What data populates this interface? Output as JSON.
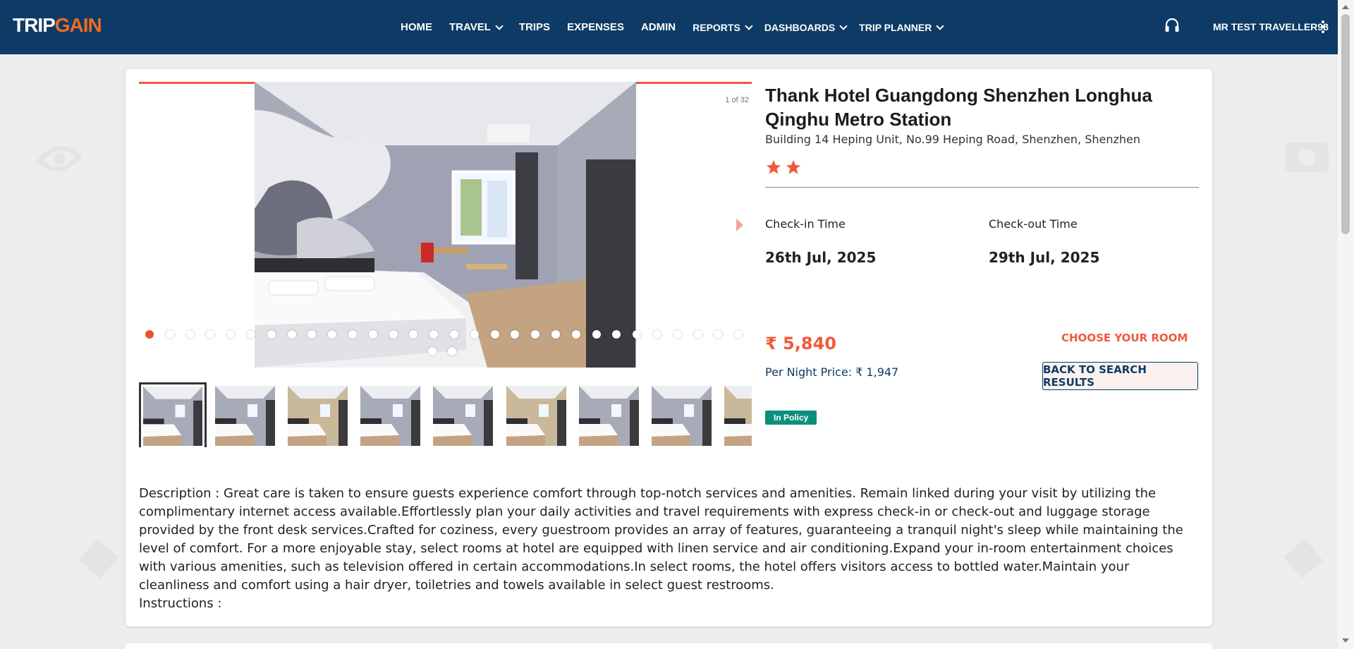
{
  "header": {
    "logo_trip": "TRIP",
    "logo_gain": "GAIN",
    "nav": [
      {
        "label": "HOME",
        "has_dropdown": false
      },
      {
        "label": "TRAVEL",
        "has_dropdown": true
      },
      {
        "label": "TRIPS",
        "has_dropdown": false
      },
      {
        "label": "EXPENSES",
        "has_dropdown": false
      },
      {
        "label": "ADMIN",
        "has_dropdown": false
      },
      {
        "label": "REPORTS",
        "has_dropdown": true
      },
      {
        "label": "DASHBOARDS",
        "has_dropdown": true
      },
      {
        "label": "TRIP PLANNER",
        "has_dropdown": true
      }
    ],
    "user_name": "MR TEST TRAVELLER98",
    "support_icon": "headset-icon",
    "menu_icon": "kebab-icon"
  },
  "gallery": {
    "counter": "1 of 32",
    "total_images": 32,
    "current_index": 1
  },
  "hotel": {
    "name": "Thank Hotel Guangdong Shenzhen Longhua Qinghu Metro Station",
    "address": "Building 14 Heping Unit, No.99 Heping Road, Shenzhen, Shenzhen",
    "star_rating": 2,
    "checkin_label": "Check-in Time",
    "checkin_value": "26th Jul, 2025",
    "checkout_label": "Check-out Time",
    "checkout_value": "29th Jul, 2025",
    "price": "₹ 5,840",
    "per_night": "Per Night Price: ₹ 1,947",
    "choose_room": "CHOOSE YOUR ROOM",
    "back_button": "BACK TO SEARCH RESULTS",
    "policy_badge": "In Policy"
  },
  "description": {
    "text": "Description : Great care is taken to ensure guests experience comfort through top-notch services and amenities. Remain linked during your visit by utilizing the complimentary internet access available.Effortlessly plan your daily activities and travel requirements with express check-in or check-out and luggage storage provided by the front desk services.Crafted for coziness, every guestroom provides an array of features, guaranteeing a tranquil night's sleep while maintaining the level of comfort. For a more enjoyable stay, select rooms at hotel are equipped with linen service and air conditioning.Expand your in-room entertainment choices with various amenities, such as television offered in certain accommodations.In select rooms, the hotel offers visitors access to bottled water.Maintain your cleanliness and comfort using a hair dryer, toiletries and towels available in select guest restrooms.",
    "instructions": "Instructions :"
  },
  "colors": {
    "header_bg": "#0d3b66",
    "accent": "#ef5a3a",
    "policy": "#0c8f7a"
  }
}
